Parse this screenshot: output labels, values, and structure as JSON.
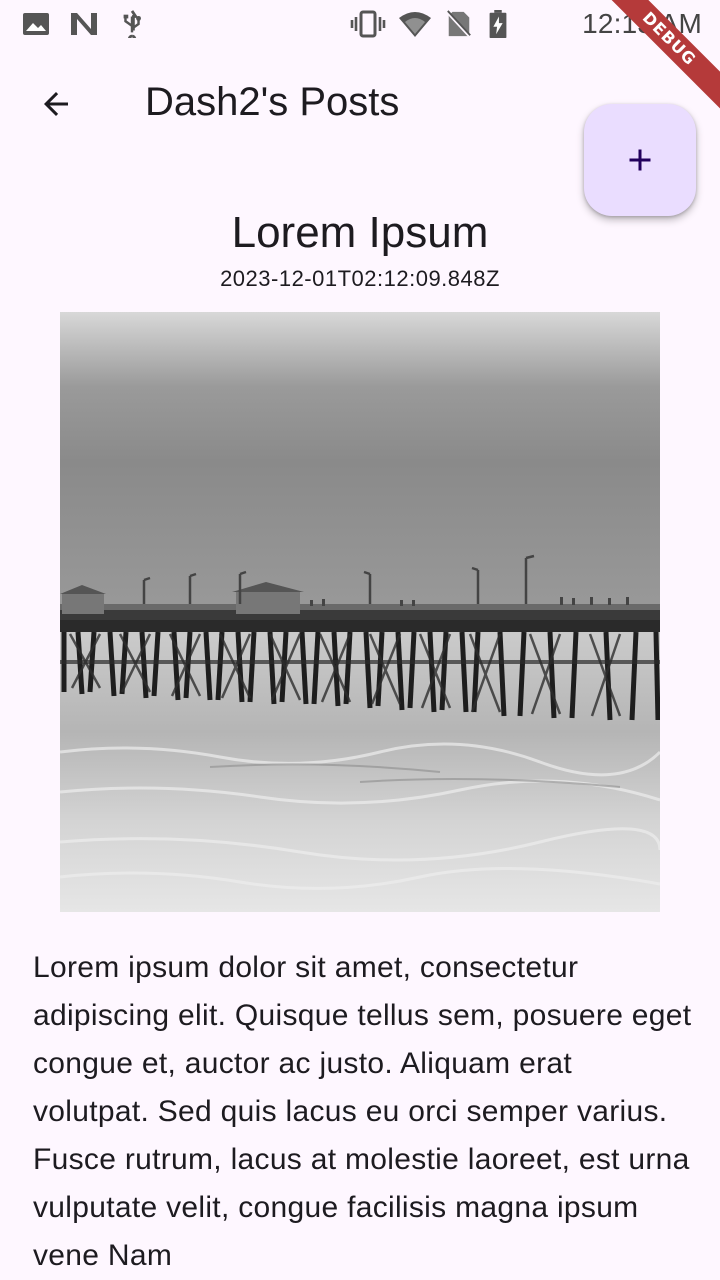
{
  "status_bar": {
    "time": "12:13 AM",
    "left_icons": [
      "image-icon",
      "n-logo-icon",
      "usb-icon"
    ],
    "right_icons": [
      "vibrate-icon",
      "wifi-icon",
      "no-sim-icon",
      "battery-charging-icon"
    ]
  },
  "debug_banner": "DEBUG",
  "app_bar": {
    "title": "Dash2's Posts",
    "back_icon": "arrow-back-icon"
  },
  "fab": {
    "icon": "add-icon",
    "background": "#EADDFF",
    "icon_color": "#21005D"
  },
  "post": {
    "title": "Lorem Ipsum",
    "date": "2023-12-01T02:12:09.848Z",
    "image": "pier-photo",
    "body": "Lorem ipsum dolor sit amet, consectetur adipiscing elit. Quisque tellus sem, posuere eget congue et, auctor ac justo. Aliquam erat volutpat. Sed quis lacus eu orci semper varius. Fusce rutrum, lacus at molestie laoreet, est urna vulputate velit, congue facilisis magna ipsum vene Nam"
  },
  "colors": {
    "background": "#FEF7FF",
    "text": "#1D1B20"
  }
}
